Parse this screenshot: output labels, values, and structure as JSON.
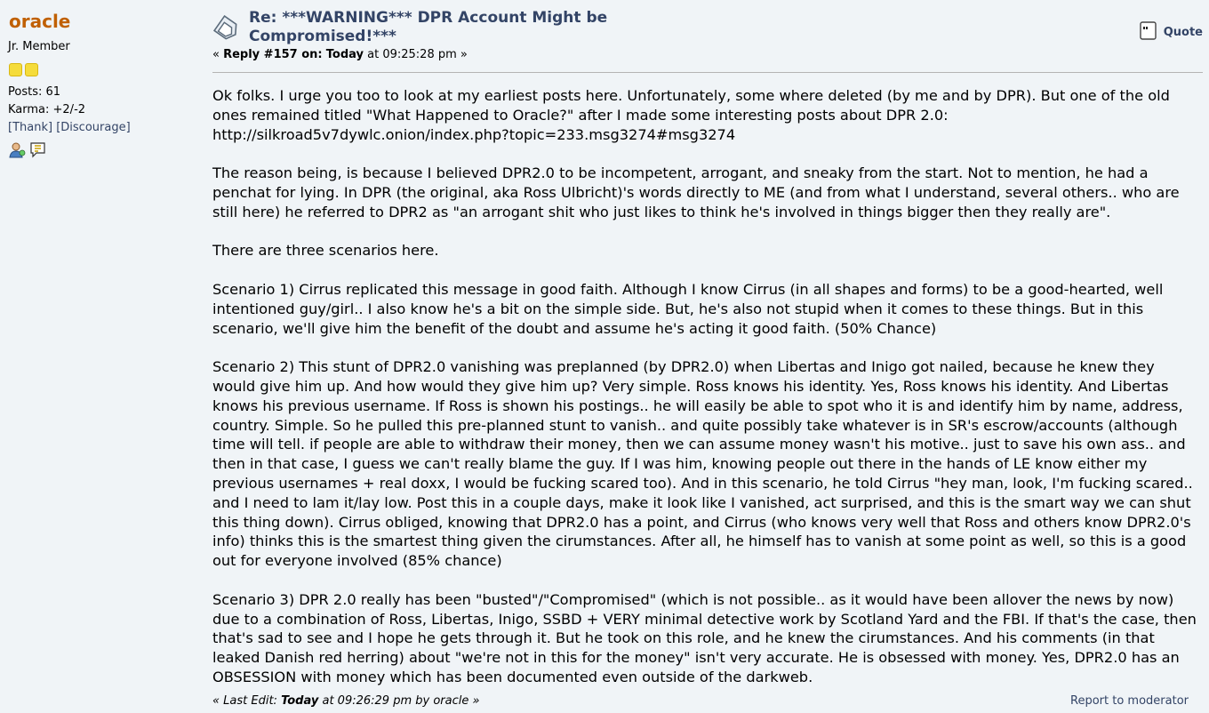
{
  "poster": {
    "name": "oracle",
    "rank": "Jr. Member",
    "posts": "Posts: 61",
    "karma": "Karma: +2/-2",
    "thank": "[Thank]",
    "discourage": "[Discourage]"
  },
  "post": {
    "title": "Re: ***WARNING*** DPR Account Might be Compromised!***",
    "reply_prefix": "« ",
    "reply_label": "Reply #157 on:",
    "reply_today": "Today",
    "reply_time": " at 09:25:28 pm »",
    "quote_label": "Quote",
    "paragraphs": [
      "Ok folks. I urge you too to look at my earliest posts here. Unfortunately, some where deleted (by me and by DPR). But one of the old ones remained titled \"What Happened to Oracle?\" after I made some interesting posts about DPR 2.0: http://silkroad5v7dywlc.onion/index.php?topic=233.msg3274#msg3274",
      "The reason being, is because I believed DPR2.0 to be incompetent, arrogant, and sneaky from the start. Not to mention, he had a penchat for lying. In DPR (the original, aka Ross Ulbricht)'s words directly to ME (and from what I understand, several others.. who are still here) he referred to DPR2 as \"an arrogant shit who just likes to think he's involved in things bigger then they really are\".",
      "There are three scenarios here.",
      "Scenario 1) Cirrus replicated this message in good faith. Although I know Cirrus (in all shapes and forms) to be a good-hearted, well intentioned guy/girl.. I also know he's a bit on the simple side. But, he's also not stupid when it comes to these things. But in this scenario, we'll give him the benefit of the doubt and assume he's acting it good faith. (50% Chance)",
      "Scenario 2) This stunt of DPR2.0 vanishing was preplanned (by DPR2.0) when Libertas and Inigo got nailed, because he knew they would give him up. And how would they give him up? Very simple. Ross knows his identity. Yes, Ross knows his identity. And Libertas knows his previous username. If Ross is shown his postings.. he will easily be able to spot who it is and identify him by name, address, country. Simple. So he pulled this pre-planned stunt to vanish.. and quite possibly take whatever is in SR's escrow/accounts (although time will tell. if people are able to withdraw their money, then we can assume money wasn't his motive.. just to save his own ass.. and then in that case, I guess we can't really blame the guy. If I was him, knowing people out there in the hands of LE know either my previous usernames + real doxx, I would be fucking scared too). And in this scenario, he told Cirrus \"hey man, look, I'm fucking scared.. and I need to lam it/lay low. Post this in a couple days, make it look like I vanished, act surprised, and this is the smart way we can shut this thing down). Cirrus obliged, knowing that DPR2.0 has a point, and Cirrus (who knows very well that Ross and others know DPR2.0's info) thinks this is the smartest thing given the cirumstances. After all, he himself has to vanish at some point as well, so this is a good out for everyone involved (85% chance)",
      "Scenario 3) DPR 2.0 really has been \"busted\"/\"Compromised\" (which is not possible.. as it would have been allover the news by now) due to a combination of Ross, Libertas, Inigo, SSBD + VERY minimal detective work by Scotland Yard and the FBI. If that's the case, then that's sad to see and I hope he gets through it. But he took on this role, and he knew the cirumstances. And his comments (in that leaked Danish red herring) about \"we're not in this for the money\" isn't very accurate. He is obsessed with money. Yes, DPR2.0 has an OBSESSION with money which has been documented even outside of the darkweb."
    ],
    "edit_prefix": "« Last Edit: ",
    "edit_today": "Today",
    "edit_suffix": " at 09:26:29 pm by oracle »",
    "report_label": "Report to moderator"
  },
  "icons": {
    "topic": "topic-icon",
    "quote": "quote-icon",
    "profile": "profile-icon",
    "message": "message-icon"
  },
  "colors": {
    "background": "#f0f4f7",
    "poster_name": "#c06002",
    "link": "#334466",
    "star": "#f5dc3b"
  }
}
